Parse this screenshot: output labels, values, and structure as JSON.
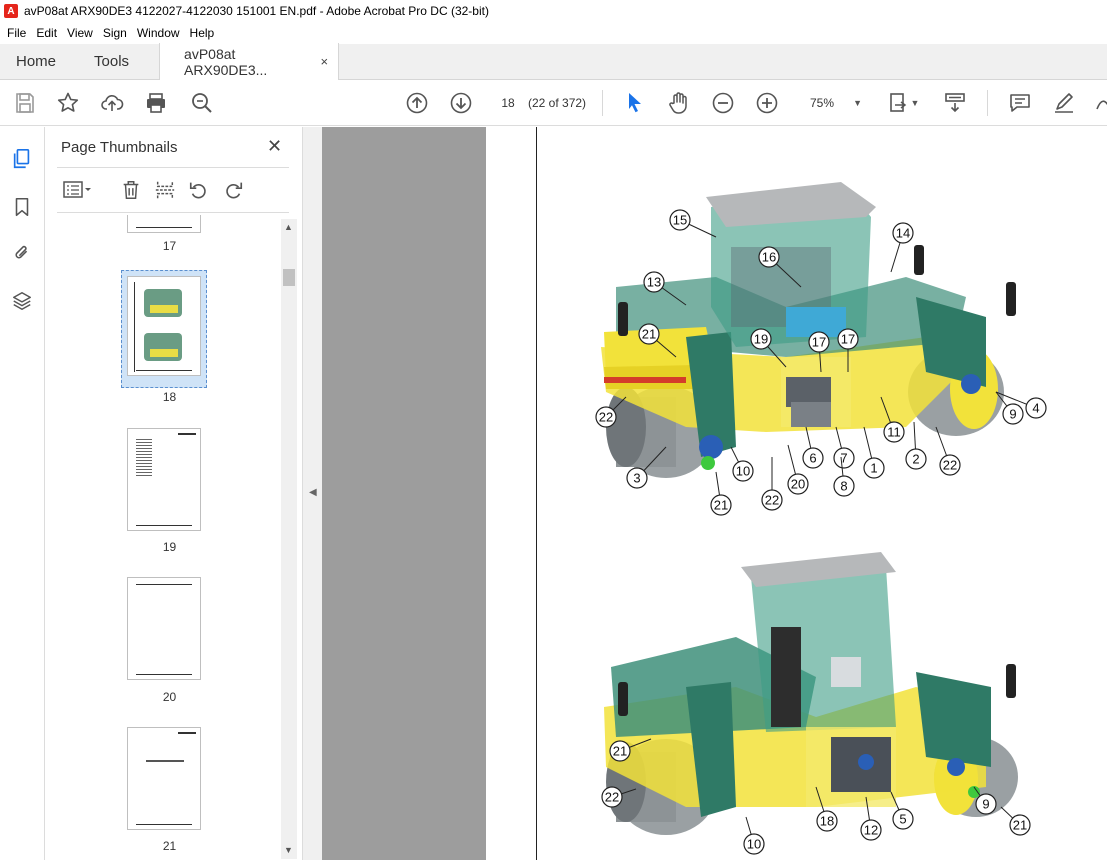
{
  "window": {
    "title": "avP08at ARX90DE3 4122027-4122030 151001 EN.pdf - Adobe Acrobat Pro DC (32-bit)"
  },
  "menu": [
    "File",
    "Edit",
    "View",
    "Sign",
    "Window",
    "Help"
  ],
  "tabs": {
    "home": "Home",
    "tools": "Tools",
    "document": "avP08at ARX90DE3...",
    "close": "×"
  },
  "toolbar": {
    "page_number": "18",
    "page_count": "(22 of 372)",
    "zoom": "75%"
  },
  "thumbnails_panel": {
    "title": "Page Thumbnails",
    "close": "✕",
    "pages": [
      {
        "label": "17"
      },
      {
        "label": "18",
        "selected": true
      },
      {
        "label": "19"
      },
      {
        "label": "20"
      },
      {
        "label": "21"
      }
    ]
  },
  "document": {
    "figure_top_callouts": [
      "15",
      "16",
      "14",
      "13",
      "21",
      "19",
      "17",
      "17",
      "22",
      "4",
      "9",
      "11",
      "2",
      "22",
      "6",
      "7",
      "1",
      "3",
      "10",
      "20",
      "8",
      "21",
      "22"
    ],
    "figure_bottom_callouts": [
      "21",
      "22",
      "18",
      "12",
      "5",
      "9",
      "21",
      "10"
    ]
  },
  "colors": {
    "accent_blue": "#1a73e8",
    "pdf_red": "#e5251b",
    "machine_green": "#3e8f7a",
    "machine_yellow": "#f2e23a"
  }
}
